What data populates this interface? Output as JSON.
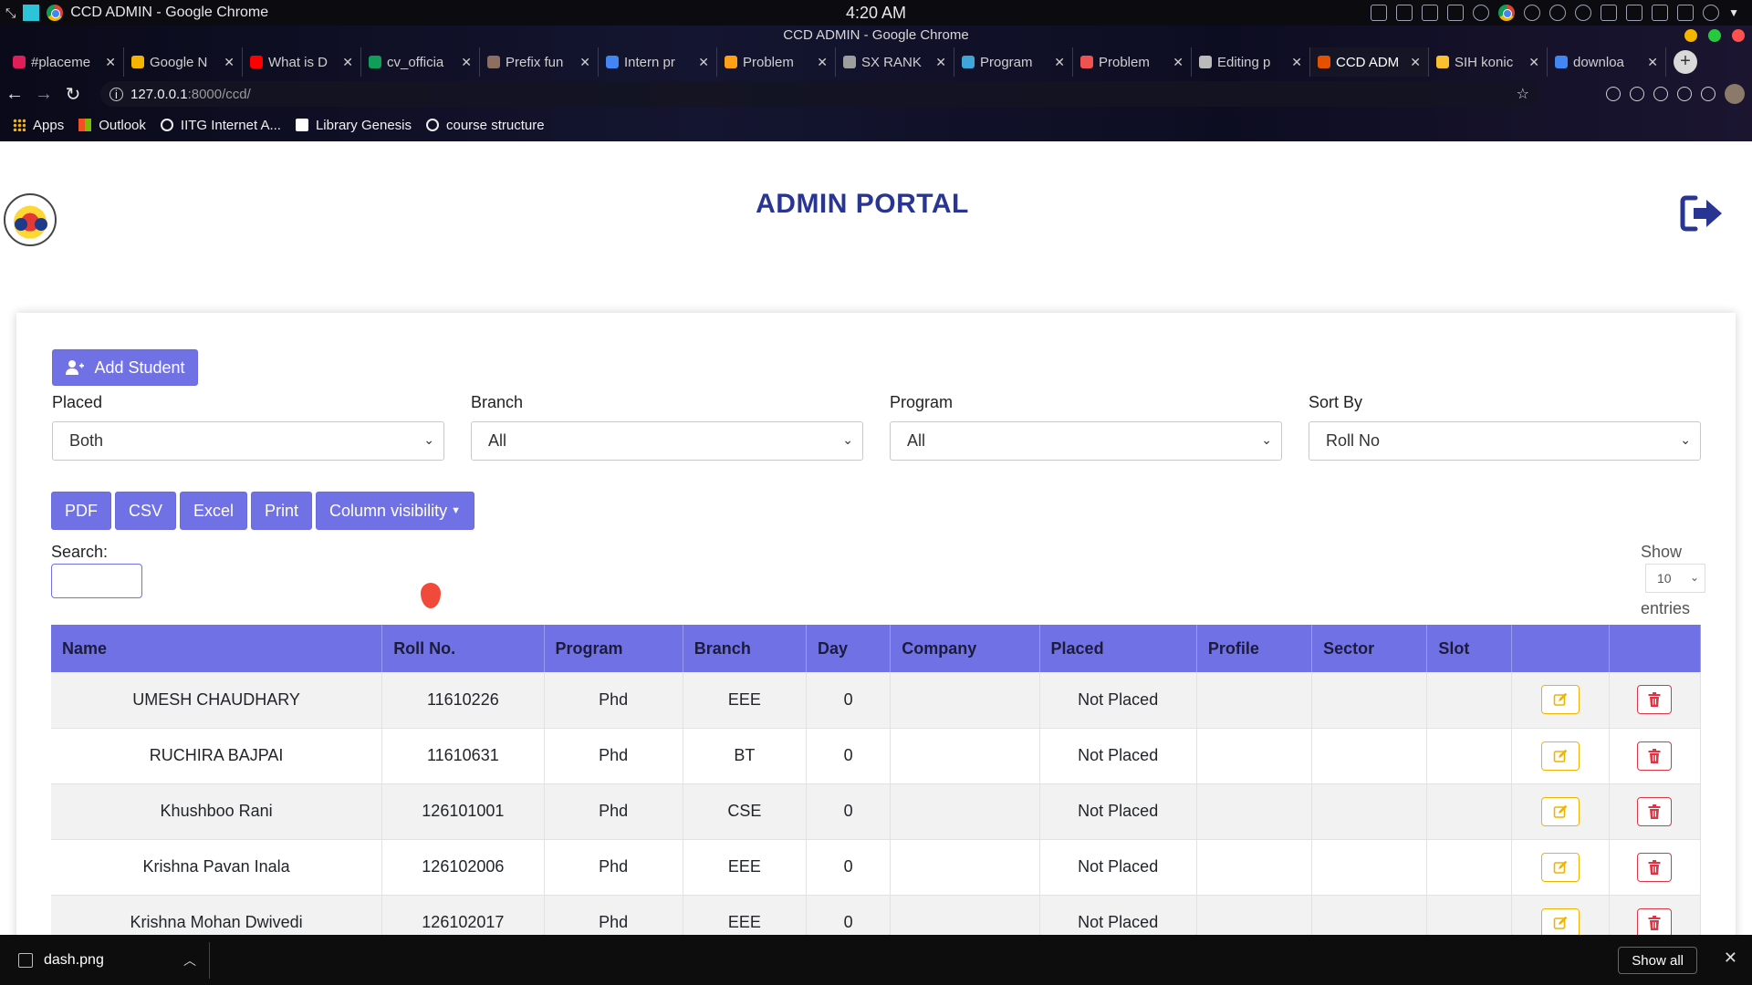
{
  "os": {
    "window_title": "CCD ADMIN - Google Chrome",
    "clock": "4:20 AM"
  },
  "browser": {
    "window_title": "CCD ADMIN - Google Chrome",
    "tabs": [
      {
        "label": "#placeme",
        "color": "#e01e5a"
      },
      {
        "label": "Google N",
        "color": "#f4b400"
      },
      {
        "label": "What is D",
        "color": "#ff0000"
      },
      {
        "label": "cv_officia",
        "color": "#0f9d58"
      },
      {
        "label": "Prefix fun",
        "color": "#8d6e63"
      },
      {
        "label": "Intern pr",
        "color": "#4285f4"
      },
      {
        "label": "Problem",
        "color": "#ffa116"
      },
      {
        "label": "SX RANK",
        "color": "#9e9e9e"
      },
      {
        "label": "Program",
        "color": "#3ea6d8"
      },
      {
        "label": "Problem",
        "color": "#ef5350"
      },
      {
        "label": "Editing p",
        "color": "#bbbbbb"
      },
      {
        "label": "CCD ADM",
        "color": "#e65100",
        "active": true
      },
      {
        "label": "SIH konic",
        "color": "#fbc02d"
      },
      {
        "label": "downloa",
        "color": "#4285f4"
      }
    ],
    "url_host": "127.0.0.1",
    "url_path": ":8000/ccd/",
    "bookmarks": [
      {
        "label": "Apps"
      },
      {
        "label": "Outlook"
      },
      {
        "label": "IITG Internet A..."
      },
      {
        "label": "Library Genesis"
      },
      {
        "label": "course structure"
      }
    ]
  },
  "page": {
    "title": "ADMIN PORTAL",
    "add_student_label": "Add Student",
    "filters": {
      "placed": {
        "label": "Placed",
        "value": "Both"
      },
      "branch": {
        "label": "Branch",
        "value": "All"
      },
      "program": {
        "label": "Program",
        "value": "All"
      },
      "sort_by": {
        "label": "Sort By",
        "value": "Roll No"
      }
    },
    "tool_buttons": {
      "pdf": "PDF",
      "csv": "CSV",
      "excel": "Excel",
      "print": "Print",
      "column_visibility": "Column visibility"
    },
    "search_label": "Search:",
    "show_label": "Show",
    "page_length": "10",
    "entries_label": "entries",
    "table": {
      "headers": [
        "Name",
        "Roll No.",
        "Program",
        "Branch",
        "Day",
        "Company",
        "Placed",
        "Profile",
        "Sector",
        "Slot",
        "",
        ""
      ],
      "rows": [
        {
          "name": "UMESH CHAUDHARY",
          "roll": "11610226",
          "program": "Phd",
          "branch": "EEE",
          "day": "0",
          "company": "",
          "placed": "Not Placed",
          "profile": "",
          "sector": "",
          "slot": ""
        },
        {
          "name": "RUCHIRA BAJPAI",
          "roll": "11610631",
          "program": "Phd",
          "branch": "BT",
          "day": "0",
          "company": "",
          "placed": "Not Placed",
          "profile": "",
          "sector": "",
          "slot": ""
        },
        {
          "name": "Khushboo Rani",
          "roll": "126101001",
          "program": "Phd",
          "branch": "CSE",
          "day": "0",
          "company": "",
          "placed": "Not Placed",
          "profile": "",
          "sector": "",
          "slot": ""
        },
        {
          "name": "Krishna Pavan Inala",
          "roll": "126102006",
          "program": "Phd",
          "branch": "EEE",
          "day": "0",
          "company": "",
          "placed": "Not Placed",
          "profile": "",
          "sector": "",
          "slot": ""
        },
        {
          "name": "Krishna Mohan Dwivedi",
          "roll": "126102017",
          "program": "Phd",
          "branch": "EEE",
          "day": "0",
          "company": "",
          "placed": "Not Placed",
          "profile": "",
          "sector": "",
          "slot": ""
        }
      ]
    }
  },
  "download_shelf": {
    "file_name": "dash.png",
    "show_all_label": "Show all"
  },
  "colors": {
    "accent": "#7171e6",
    "title": "#283593",
    "edit": "#f0b400",
    "delete": "#dc3545"
  }
}
